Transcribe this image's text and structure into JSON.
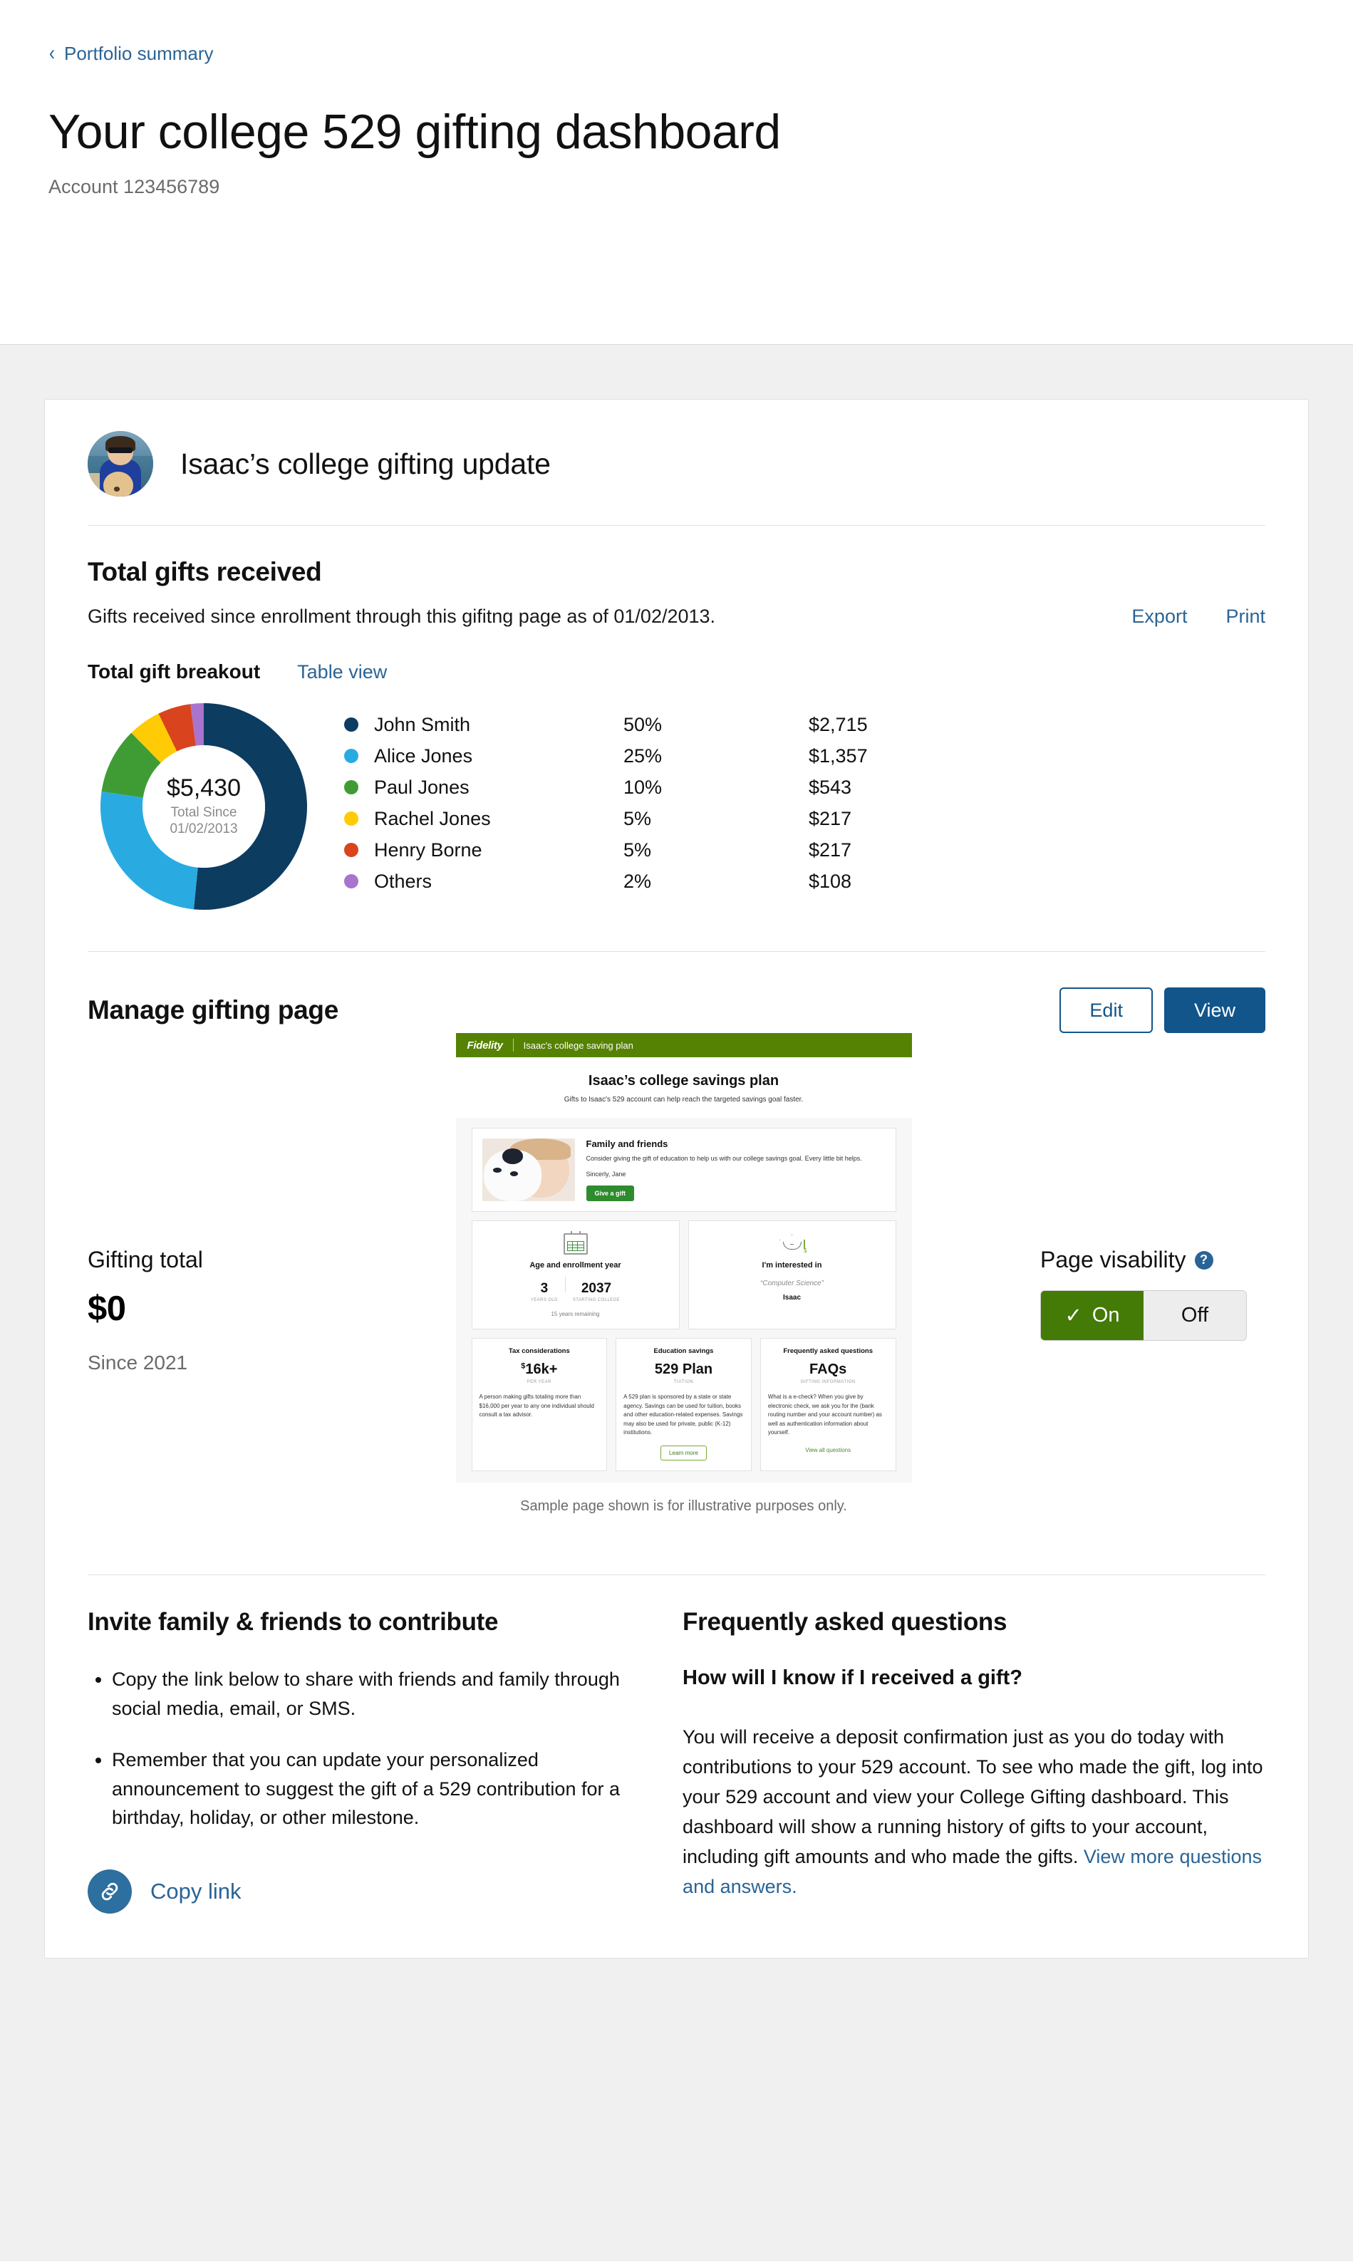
{
  "header": {
    "breadcrumb": "Portfolio summary",
    "title": "Your college 529 gifting dashboard",
    "account": "Account 123456789"
  },
  "card": {
    "avatar_alt": "Isaac profile photo",
    "title": "Isaac’s college gifting update"
  },
  "gifts": {
    "heading": "Total gifts received",
    "subtext": "Gifts received since enrollment through this gifitng page as of 01/02/2013.",
    "export_label": "Export",
    "print_label": "Print",
    "breakout_label": "Total gift breakout",
    "table_view_label": "Table view"
  },
  "chart_data": {
    "type": "pie",
    "title": "Total gift breakout",
    "center_amount": "$5,430",
    "center_caption_line1": "Total Since",
    "center_caption_line2": "01/02/2013",
    "categories": [
      "John Smith",
      "Alice Jones",
      "Paul Jones",
      "Rachel Jones",
      "Henry Borne",
      "Others"
    ],
    "values": [
      50,
      25,
      10,
      5,
      5,
      2
    ],
    "percent_labels": [
      "50%",
      "25%",
      "10%",
      "5%",
      "5%",
      "2%"
    ],
    "amount_labels": [
      "$2,715",
      "$1,357",
      "$543",
      "$217",
      "$217",
      "$108"
    ],
    "amounts": [
      2715,
      1357,
      543,
      217,
      217,
      108
    ],
    "colors": [
      "#0d3c61",
      "#29abe2",
      "#3f9c35",
      "#ffcb05",
      "#d9431e",
      "#a974ce"
    ],
    "legend_position": "right",
    "donut": true,
    "total": 5430
  },
  "manage": {
    "heading": "Manage gifting page",
    "edit_label": "Edit",
    "view_label": "View",
    "gifting_total_label": "Gifting total",
    "gifting_total_amount": "$0",
    "gifting_total_since": "Since 2021",
    "visability_label": "Page visability",
    "help_glyph": "?",
    "toggle_on": "On",
    "toggle_off": "Off",
    "toggle_check": "✓",
    "caption": "Sample page shown is for illustrative purposes only."
  },
  "preview": {
    "brand": "Fidelity",
    "account_name": "Isaac's college saving plan",
    "hero_title": "Isaac’s college savings plan",
    "hero_sub": "Gifts to Isaac's 529 account can help reach the targeted savings goal faster.",
    "family_title": "Family and friends",
    "family_body": "Consider giving the gift of education to help us with our college savings goal. Every little bit helps.",
    "family_sign": "Sincerly, Jane",
    "give_button": "Give a gift",
    "age_title": "Age and enrollment year",
    "age_value": "3",
    "age_label": "YEARS OLD",
    "year_value": "2037",
    "year_label": "STARTING COLLEGE",
    "years_remaining": "15 years remaining",
    "interest_title": "I'm interested in",
    "interest_value": "“Computer Science”",
    "interest_by": "Isaac",
    "tax_title": "Tax considerations",
    "tax_big": "16k+",
    "tax_currency": "$",
    "tax_label": "PER YEAR",
    "tax_body": "A person making gifts totaling more than $16,000 per year to any one individual should consult a tax advisor.",
    "edu_title": "Education savings",
    "edu_big": "529 Plan",
    "edu_label": "TUITION",
    "edu_body": "A 529 plan is sponsored by a state or state agency. Savings can be used for tuition, books and other education-related expenses. Savings may also be used for private, public (K-12) institutions.",
    "edu_button": "Learn more",
    "faq_title": "Frequently asked questions",
    "faq_big": "FAQs",
    "faq_label": "GIFTING INFORMATION",
    "faq_body": "What is a e-check? When you give by electronic check, we ask you for the (bank routing number and your account number) as well as authentication information about yourself.",
    "faq_link": "View all questions"
  },
  "invite": {
    "heading": "Invite family & friends to contribute",
    "bullets": [
      "Copy the link below to share with friends and family through social media, email, or SMS.",
      "Remember that you can update your personalized announcement to suggest the gift of a 529 contribution for a birthday, holiday, or other milestone."
    ],
    "copy_link_label": "Copy link"
  },
  "faq": {
    "heading": "Frequently asked questions",
    "question": "How will I know if I received a gift?",
    "answer": "You will receive a deposit confirmation just as you do today with contributions to your 529 account. To see who made the gift, log into your 529 account and view your College Gifting dashboard. This dashboard will show a running history of gifts to your account, including gift amounts and who made the gifts. ",
    "answer_link": "View more questions and answers."
  },
  "colors": {
    "link": "#2a6496",
    "primary_button": "#12558a",
    "toggle_on": "#447a06",
    "brand_green": "#568203"
  }
}
